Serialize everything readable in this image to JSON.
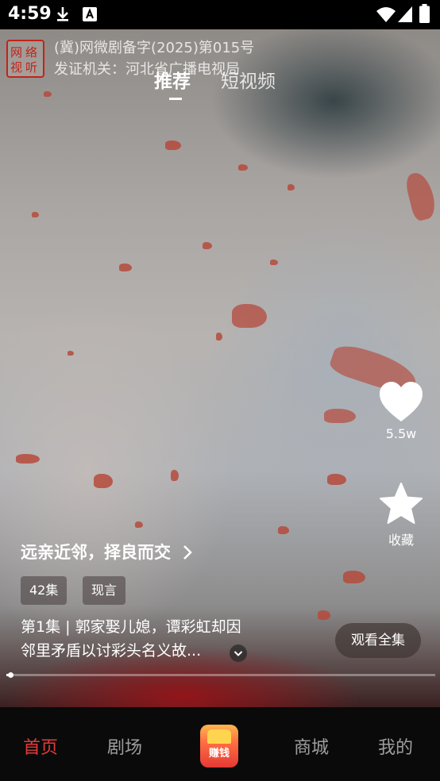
{
  "status_bar": {
    "time": "4:59",
    "icons": [
      "download-icon",
      "a-box-icon",
      "wifi-icon",
      "signal-icon",
      "battery-icon"
    ]
  },
  "license": {
    "logo_text": "网络视听",
    "line1": "(冀)网微剧备字(2025)第015号",
    "line2": "发证机关：河北省广播电视局"
  },
  "top_tabs": [
    {
      "label": "推荐",
      "active": true
    },
    {
      "label": "短视频",
      "active": false
    }
  ],
  "actions": {
    "like_count": "5.5w",
    "favorite_label": "收藏"
  },
  "drama": {
    "title": "远亲近邻，择良而交",
    "tags": [
      "42集",
      "现言"
    ],
    "description_line1": "第1集 | 郭家娶儿媳，谭彩虹却因",
    "description_line2": "邻里矛盾以讨彩头名义故...",
    "watch_all_label": "观看全集",
    "progress": 0.01
  },
  "bottom_nav": {
    "items": [
      {
        "label": "首页",
        "active": true
      },
      {
        "label": "剧场",
        "active": false
      },
      {
        "label": "赚钱",
        "active": false
      },
      {
        "label": "商城",
        "active": false
      },
      {
        "label": "我的",
        "active": false
      }
    ]
  },
  "colors": {
    "accent": "#e23b3b",
    "license_red": "#c2231a"
  }
}
